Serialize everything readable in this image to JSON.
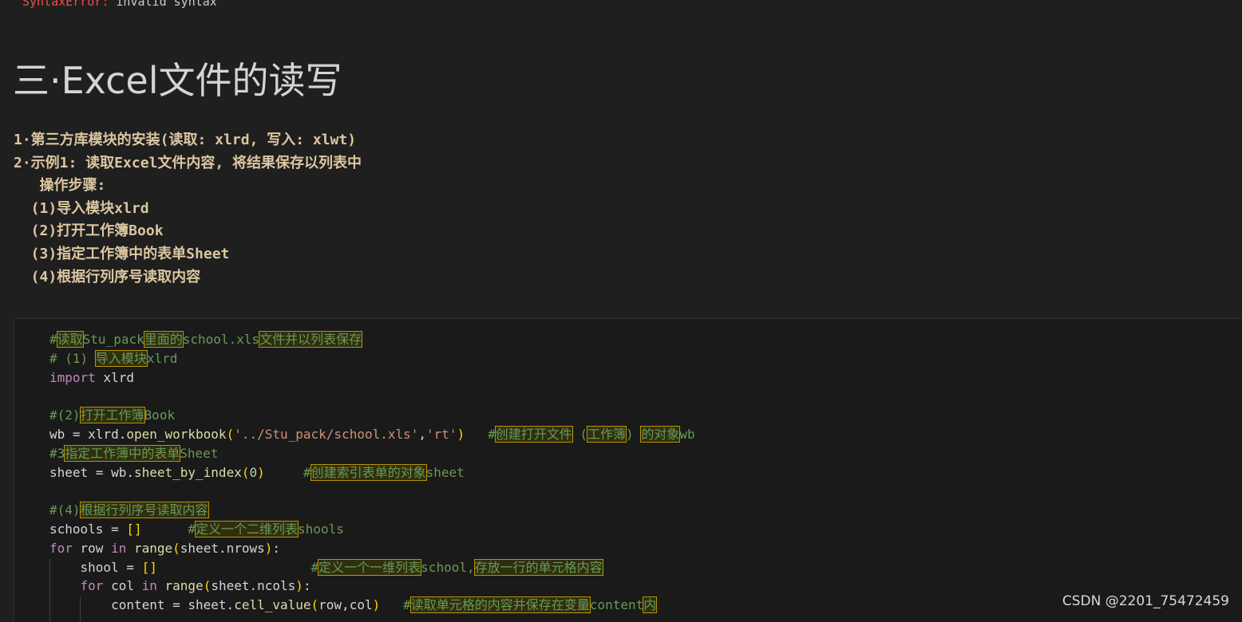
{
  "error": {
    "type": "SyntaxError:",
    "message": " invalid syntax"
  },
  "title": "三·Excel文件的读写",
  "markdown_lines": [
    "1·第三方库模块的安装(读取: xlrd, 写入: xlwt)",
    "2·示例1: 读取Excel文件内容, 将结果保存以列表中",
    "   操作步骤:",
    "  (1)导入模块xlrd",
    "  (2)打开工作簿Book",
    "  (3)指定工作簿中的表单Sheet",
    "  (4)根据行列序号读取内容"
  ],
  "code": {
    "l1": {
      "comment": "#读取Stu_pack里面的school.xls文件并以列表保存"
    },
    "l2": {
      "comment": "# (1) 导入模块xlrd"
    },
    "l3": {
      "kw": "import",
      "rest": " xlrd"
    },
    "l5": {
      "comment": "#(2)打开工作簿Book"
    },
    "l6": {
      "pre": "wb = xlrd.",
      "fn": "open_workbook",
      "open": "(",
      "s1": "'../Stu_pack/school.xls'",
      "comma": ",",
      "s2": "'rt'",
      "close": ")",
      "pad": "   ",
      "comment": "#创建打开文件 (工作簿) 的对象wb"
    },
    "l7": {
      "comment": "#3指定工作簿中的表单Sheet"
    },
    "l8": {
      "pre": "sheet = wb.",
      "fn": "sheet_by_index",
      "open": "(",
      "num": "0",
      "close": ")",
      "pad": "     ",
      "comment": "#创建索引表单的对象sheet"
    },
    "l10": {
      "comment": "#(4)根据行列序号读取内容"
    },
    "l11": {
      "pre": "schools = ",
      "br": "[]",
      "pad": "      ",
      "comment": "#定义一个二维列表shools"
    },
    "l12": {
      "kw1": "for",
      "mid1": " row ",
      "kw2": "in",
      "sp": " ",
      "fn": "range",
      "open": "(",
      "arg": "sheet.nrows",
      "close": ")",
      "end": ":"
    },
    "l13": {
      "pre": "    shool = ",
      "br": "[]",
      "pad": "                    ",
      "comment": "#定义一个一维列表school,存放一行的单元格内容"
    },
    "l14": {
      "ind": "    ",
      "kw1": "for",
      "mid1": " col ",
      "kw2": "in",
      "sp": " ",
      "fn": "range",
      "open": "(",
      "arg": "sheet.ncols",
      "close": ")",
      "end": ":"
    },
    "l15": {
      "pre": "        content = sheet.",
      "fn": "cell_value",
      "open": "(",
      "arg": "row,col",
      "close": ")",
      "pad": "   ",
      "comment": "#读取单元格的内容并保存在变量content内"
    }
  },
  "watermark": "CSDN @2201_75472459"
}
